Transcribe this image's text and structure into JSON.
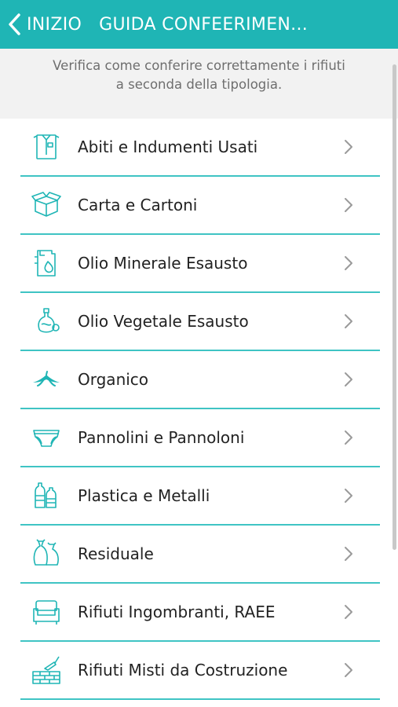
{
  "header": {
    "back_label": "INIZIO",
    "title": "GUIDA CONFEERIMEN...",
    "bg_color": "#1fb5b5"
  },
  "intro": {
    "text": "Verifica come conferire correttamente i rifiuti a seconda della tipologia."
  },
  "accent_color": "#3fc4c4",
  "items": [
    {
      "label": "Abiti e Indumenti Usati",
      "icon": "shirt-icon"
    },
    {
      "label": "Carta e Cartoni",
      "icon": "cardboard-box-icon"
    },
    {
      "label": "Olio Minerale Esausto",
      "icon": "oil-canister-icon"
    },
    {
      "label": "Olio Vegetale Esausto",
      "icon": "oil-bottle-icon"
    },
    {
      "label": "Organico",
      "icon": "banana-peel-icon"
    },
    {
      "label": "Pannolini e Pannoloni",
      "icon": "diaper-icon"
    },
    {
      "label": "Plastica e Metalli",
      "icon": "plastic-bottles-icon"
    },
    {
      "label": "Residuale",
      "icon": "trash-bags-icon"
    },
    {
      "label": "Rifiuti Ingombranti, RAEE",
      "icon": "armchair-icon"
    },
    {
      "label": "Rifiuti Misti da Costruzione",
      "icon": "bricks-trowel-icon"
    }
  ]
}
